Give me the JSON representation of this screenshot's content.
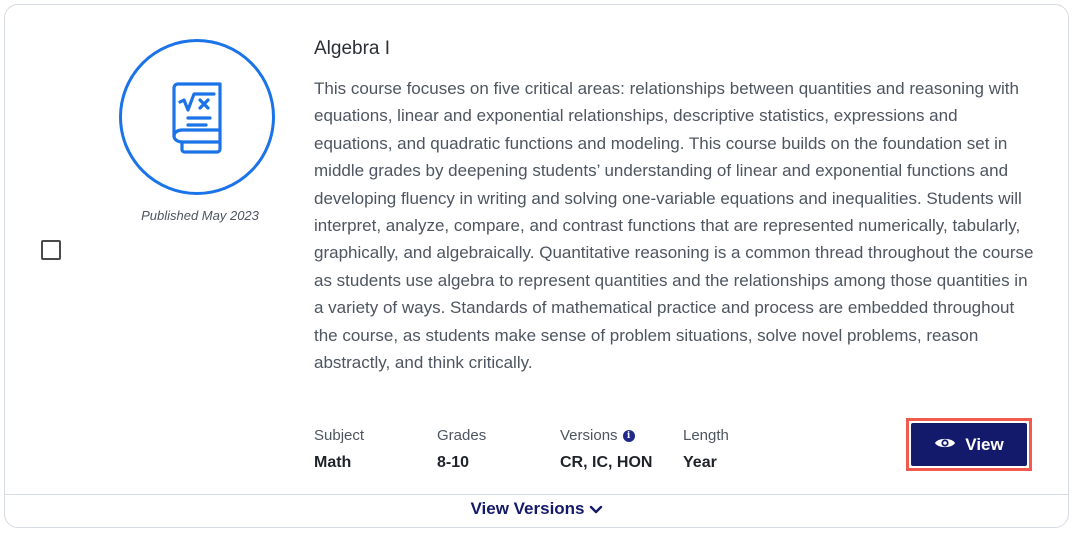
{
  "course": {
    "title": "Algebra I",
    "published": "Published May 2023",
    "icon": "algebra-book-icon",
    "description": "This course focuses on five critical areas: relationships between quantities and reasoning with equations, linear and exponential relationships, descriptive statistics, expressions and equations, and quadratic functions and modeling. This course builds on the foundation set in middle grades by deepening students’ understanding of linear and exponential functions and developing fluency in writing and solving one-variable equations and inequalities. Students will interpret, analyze, compare, and contrast functions that are represented numerically, tabularly, graphically, and algebraically. Quantitative reasoning is a common thread throughout the course as students use algebra to represent quantities and the relationships among those quantities in a variety of ways. Standards of mathematical practice and process are embedded throughout the course, as students make sense of problem situations, solve novel problems, reason abstractly, and think critically."
  },
  "meta": {
    "subject_label": "Subject",
    "subject_value": "Math",
    "grades_label": "Grades",
    "grades_value": "8-10",
    "versions_label": "Versions",
    "versions_value": "CR, IC, HON",
    "length_label": "Length",
    "length_value": "Year"
  },
  "actions": {
    "view_label": "View",
    "view_versions_label": "View Versions"
  },
  "colors": {
    "accent_blue": "#1a73e8",
    "navy": "#141a6b",
    "highlight": "#f05a4f"
  }
}
